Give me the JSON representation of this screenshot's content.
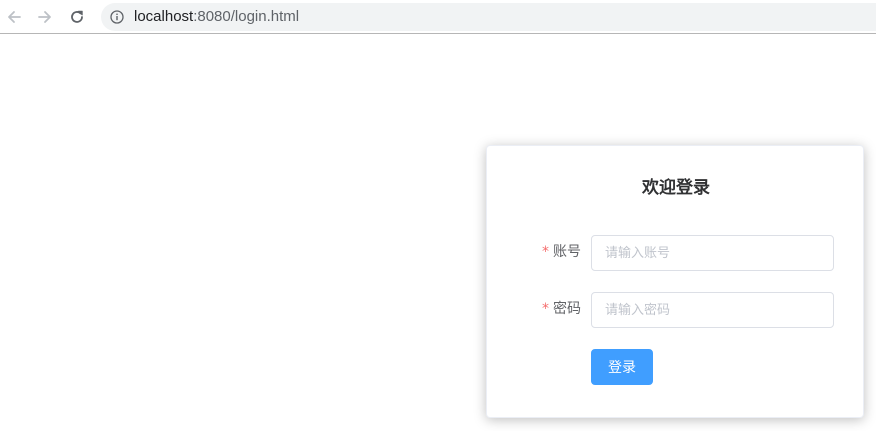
{
  "browser": {
    "url_host": "localhost",
    "url_rest": ":8080/login.html",
    "icons": {
      "back": "arrow-left-icon",
      "forward": "arrow-right-icon",
      "reload": "reload-icon",
      "site_info": "info-icon"
    }
  },
  "login": {
    "title": "欢迎登录",
    "required_mark": "*",
    "account_label": "账号",
    "account_placeholder": "请输入账号",
    "account_value": "",
    "password_label": "密码",
    "password_placeholder": "请输入密码",
    "password_value": "",
    "submit_label": "登录"
  },
  "colors": {
    "primary": "#409eff",
    "required": "#f56c6c",
    "title_text": "#303133",
    "label_text": "#606266",
    "placeholder": "#c0c4cc"
  }
}
